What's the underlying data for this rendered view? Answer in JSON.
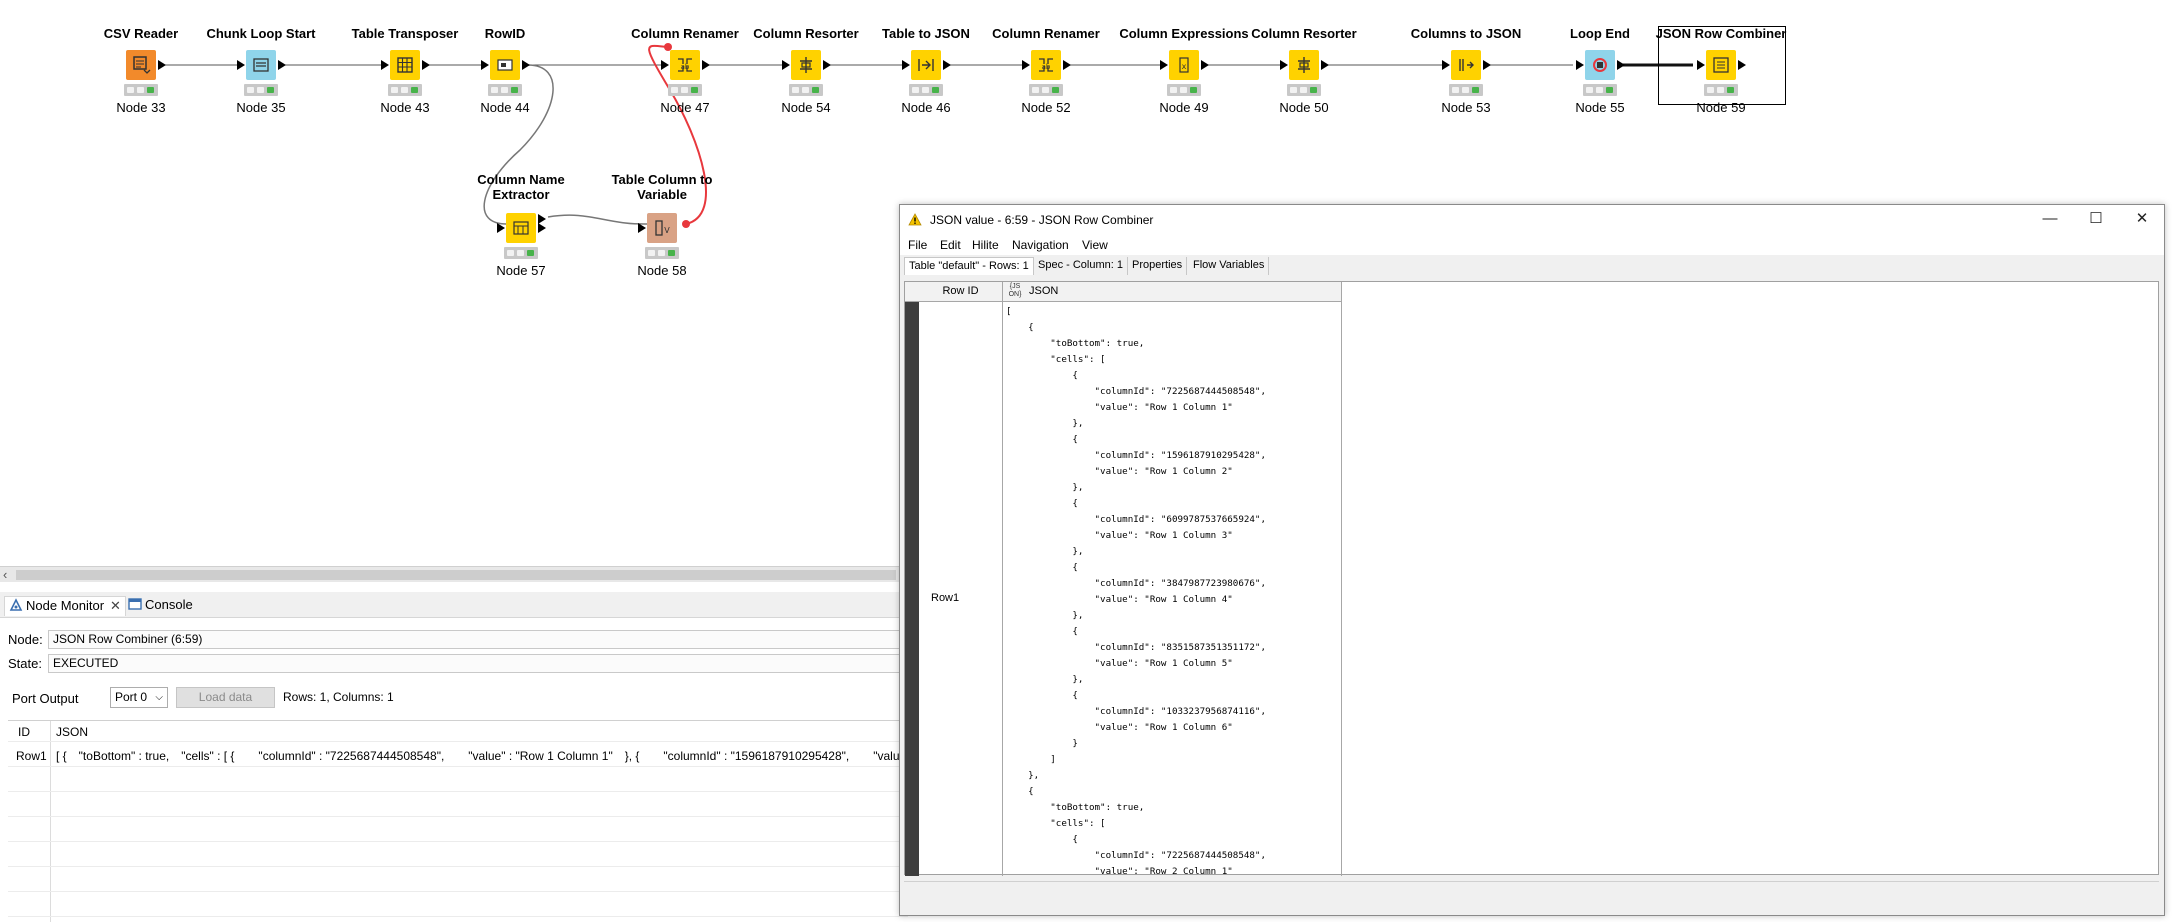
{
  "workflow": {
    "nodes": [
      {
        "title": "CSV Reader",
        "label": "Node 33",
        "icon": "csv-reader-icon",
        "color": "#f28a2b"
      },
      {
        "title": "Chunk Loop Start",
        "label": "Node 35",
        "icon": "loop-start-icon",
        "color": "#8fd4ea"
      },
      {
        "title": "Table Transposer",
        "label": "Node 43",
        "icon": "table-transposer-icon",
        "color": "#ffd200"
      },
      {
        "title": "RowID",
        "label": "Node 44",
        "icon": "rowid-icon",
        "color": "#ffd200"
      },
      {
        "title": "Column Renamer",
        "label": "Node 47",
        "icon": "column-renamer-icon",
        "color": "#ffd200"
      },
      {
        "title": "Column Resorter",
        "label": "Node 54",
        "icon": "column-resorter-icon",
        "color": "#ffd200"
      },
      {
        "title": "Table to JSON",
        "label": "Node 46",
        "icon": "table-to-json-icon",
        "color": "#ffd200"
      },
      {
        "title": "Column Renamer",
        "label": "Node 52",
        "icon": "column-renamer-icon",
        "color": "#ffd200"
      },
      {
        "title": "Column Expressions",
        "label": "Node 49",
        "icon": "column-expressions-icon",
        "color": "#ffd200"
      },
      {
        "title": "Column Resorter",
        "label": "Node 50",
        "icon": "column-resorter-icon",
        "color": "#ffd200"
      },
      {
        "title": "Columns to JSON",
        "label": "Node 53",
        "icon": "columns-to-json-icon",
        "color": "#ffd200"
      },
      {
        "title": "Loop End",
        "label": "Node 55",
        "icon": "loop-end-icon",
        "color": "#8fd4ea"
      },
      {
        "title": "JSON Row Combiner",
        "label": "Node 59",
        "icon": "json-row-combiner-icon",
        "color": "#ffd200"
      },
      {
        "title": "Column Name Extractor",
        "label": "Node 57",
        "icon": "column-name-extractor-icon",
        "color": "#ffd200"
      },
      {
        "title": "Table Column to Variable",
        "label": "Node 58",
        "icon": "table-column-to-variable-icon",
        "color": "#d9a285"
      }
    ]
  },
  "bottom_panel": {
    "tabs": {
      "monitor": "Node Monitor",
      "console": "Console"
    },
    "node_label": "Node:",
    "node_value": "JSON Row Combiner  (6:59)",
    "state_label": "State:",
    "state_value": "EXECUTED",
    "port_output_label": "Port Output",
    "port_select": "Port 0",
    "load_button": "Load data",
    "rows_cols": "Rows: 1, Columns: 1",
    "table": {
      "headers": [
        "ID",
        "JSON"
      ],
      "rows": [
        {
          "id": "Row1",
          "json": "[ { \"toBottom\" : true, \"cells\" : [ {  \"columnId\" : \"7225687444508548\",  \"value\" : \"Row 1 Column 1\" }, {  \"columnId\" : \"1596187910295428\",  \"value"
        }
      ]
    }
  },
  "json_window": {
    "title": "JSON value - 6:59 - JSON Row Combiner",
    "menu": [
      "File",
      "Edit",
      "Hilite",
      "Navigation",
      "View"
    ],
    "tabs": [
      "Table \"default\" - Rows: 1",
      "Spec - Column: 1",
      "Properties",
      "Flow Variables"
    ],
    "header_rowid": "Row ID",
    "header_json_icon": "{JS ON}",
    "header_json": "JSON",
    "row_id": "Row1",
    "json_text": "[\n    {\n        \"toBottom\": true,\n        \"cells\": [\n            {\n                \"columnId\": \"7225687444508548\",\n                \"value\": \"Row 1 Column 1\"\n            },\n            {\n                \"columnId\": \"1596187910295428\",\n                \"value\": \"Row 1 Column 2\"\n            },\n            {\n                \"columnId\": \"6099787537665924\",\n                \"value\": \"Row 1 Column 3\"\n            },\n            {\n                \"columnId\": \"3847987723980676\",\n                \"value\": \"Row 1 Column 4\"\n            },\n            {\n                \"columnId\": \"8351587351351172\",\n                \"value\": \"Row 1 Column 5\"\n            },\n            {\n                \"columnId\": \"1033237956874116\",\n                \"value\": \"Row 1 Column 6\"\n            }\n        ]\n    },\n    {\n        \"toBottom\": true,\n        \"cells\": [\n            {\n                \"columnId\": \"7225687444508548\",\n                \"value\": \"Row 2 Column 1\""
  }
}
